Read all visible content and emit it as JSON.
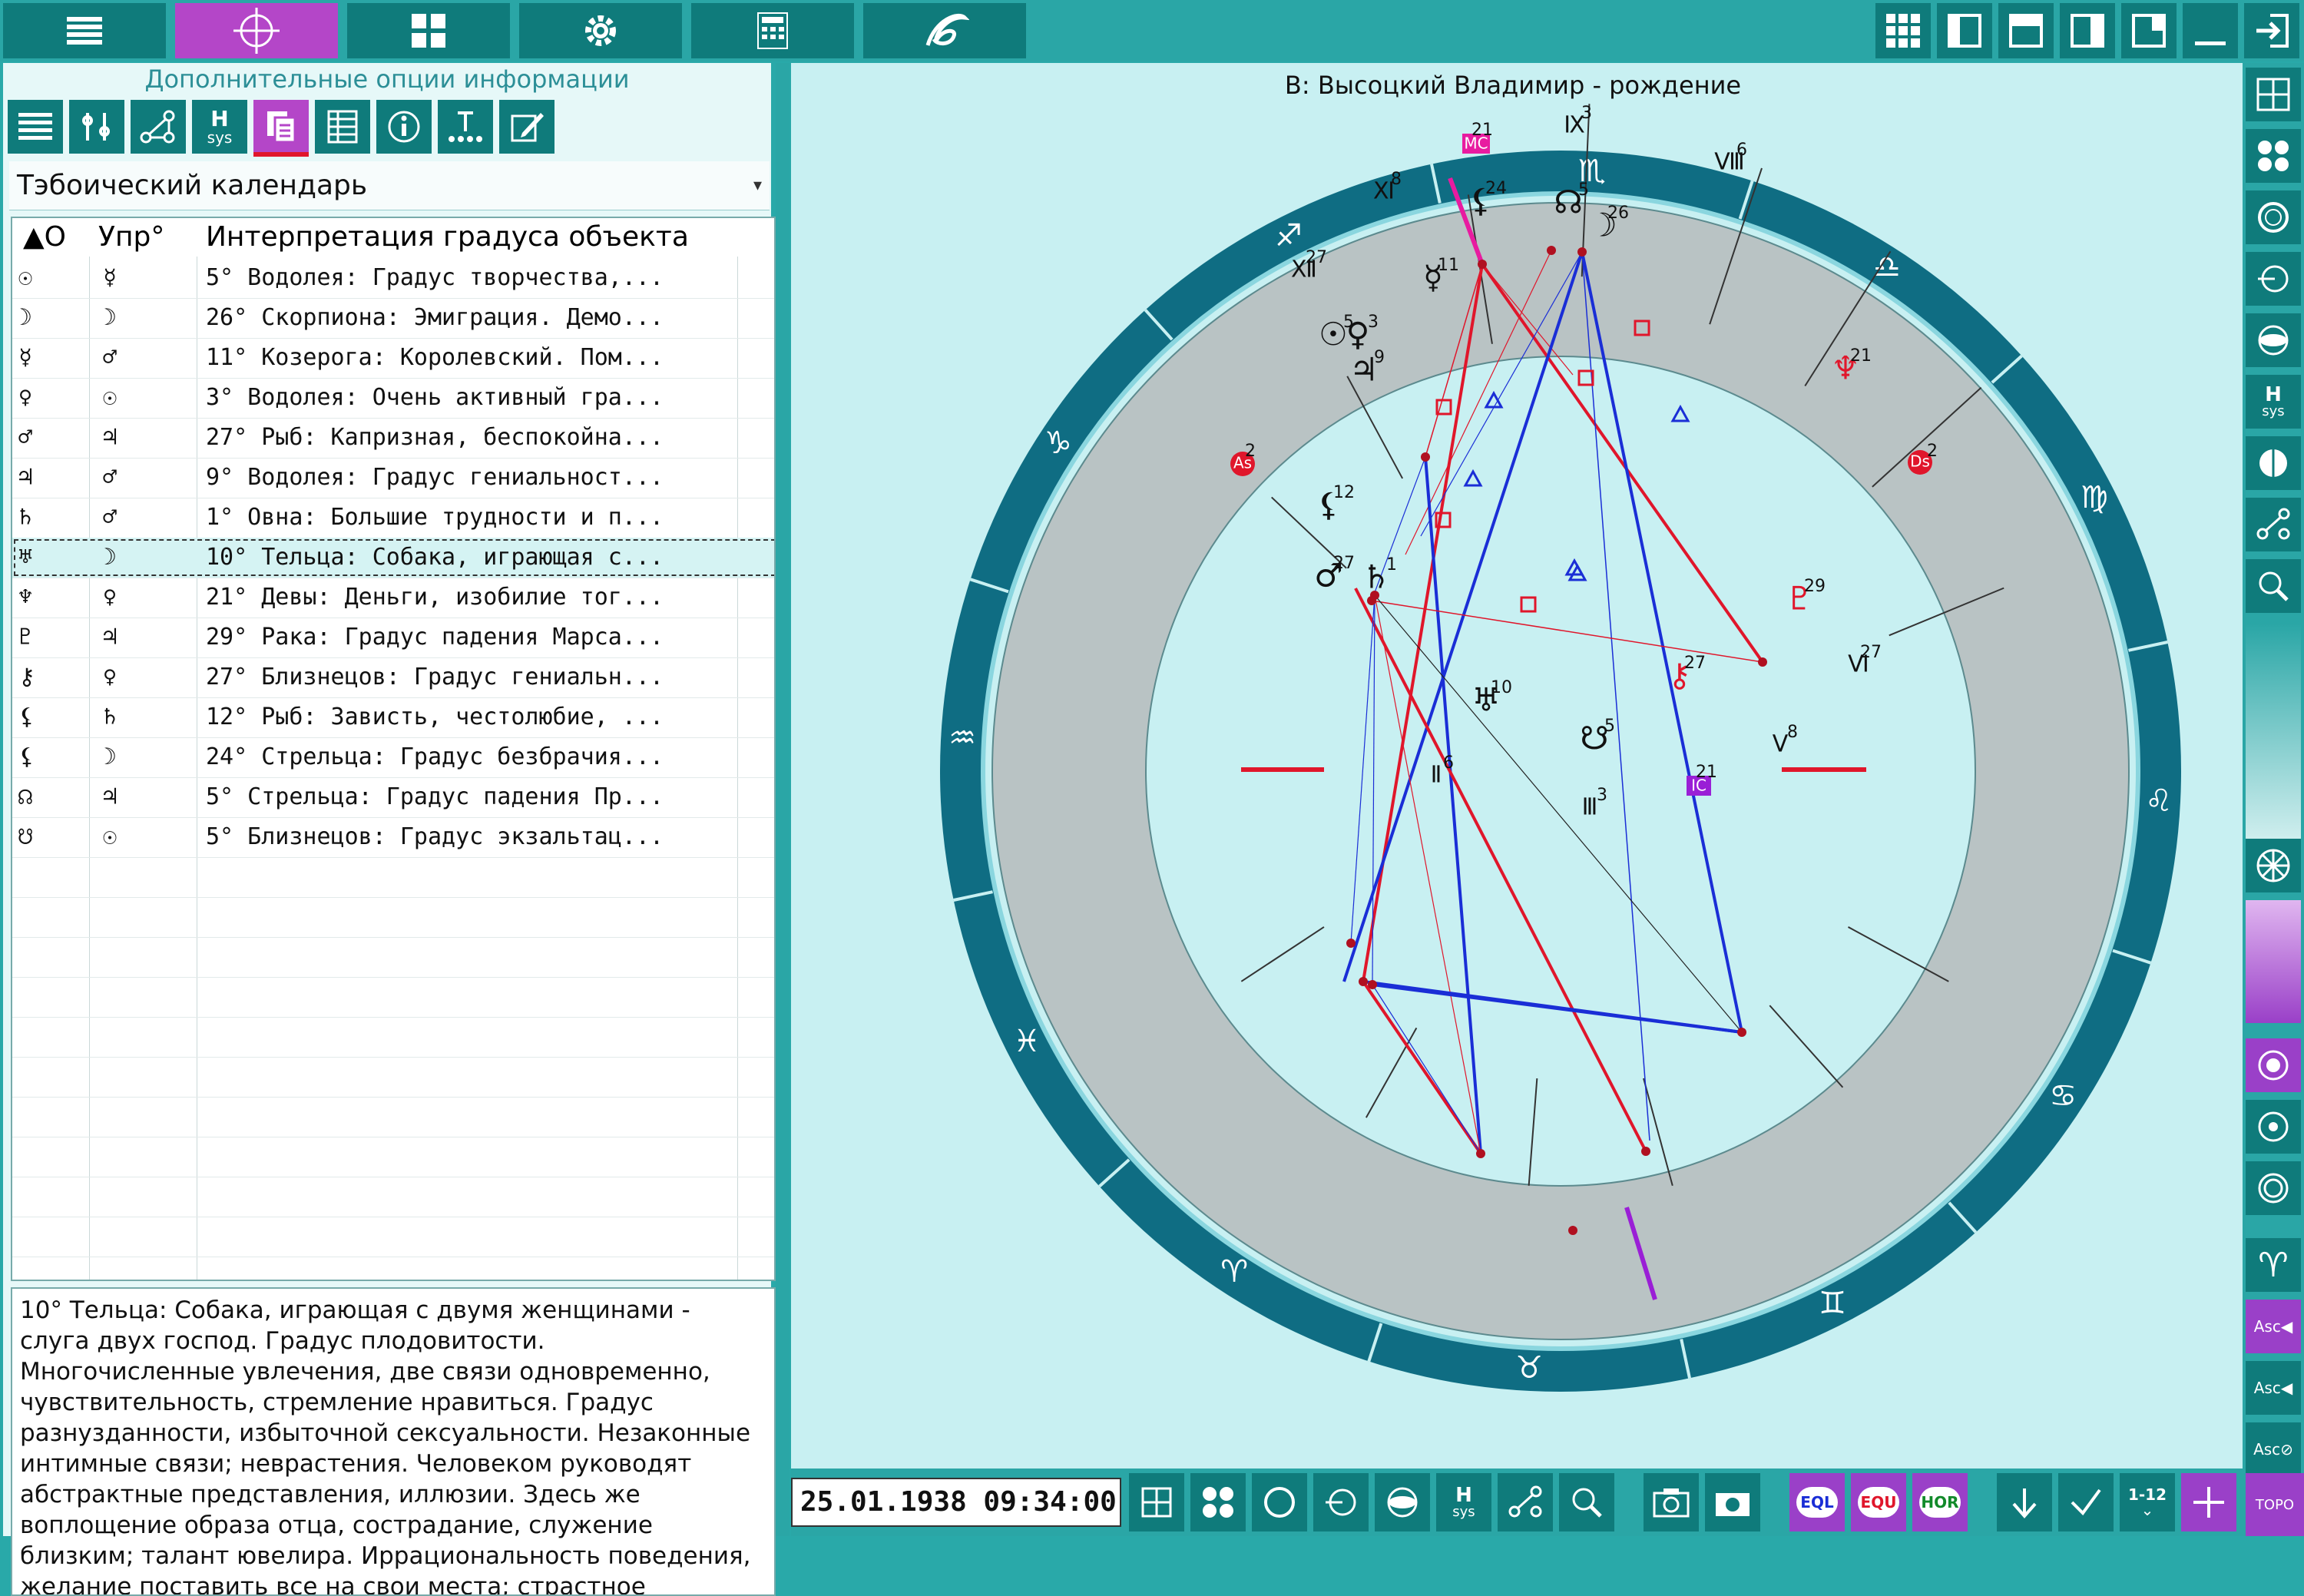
{
  "left_panel": {
    "subtitle": "Дополнительные опции информации",
    "dropdown_value": "Тэбоический календарь",
    "hsys_h": "H",
    "hsys_sys": "sys",
    "columns": [
      "▲O",
      "Упр°",
      "Интерпретация градуса объекта"
    ],
    "rows": [
      {
        "obj": "☉",
        "ruler": "☿",
        "text": "5° Водолея: Градус творчества,..."
      },
      {
        "obj": "☽",
        "ruler": "☽",
        "text": "26° Скорпиона: Эмиграция. Демо..."
      },
      {
        "obj": "☿",
        "ruler": "♂",
        "text": "11° Козерога: Королевский. Пом..."
      },
      {
        "obj": "♀",
        "ruler": "☉",
        "text": "3° Водолея: Очень активный гра..."
      },
      {
        "obj": "♂",
        "ruler": "♃",
        "text": "27° Рыб: Капризная, беспокойна..."
      },
      {
        "obj": "♃",
        "ruler": "♂",
        "text": "9° Водолея: Градус гениальност..."
      },
      {
        "obj": "♄",
        "ruler": "♂",
        "text": "1° Овна: Большие трудности и п..."
      },
      {
        "obj": "♅",
        "ruler": "☽",
        "text": "10° Тельца: Собака, играющая с..."
      },
      {
        "obj": "♆",
        "ruler": "♀",
        "text": "21° Девы: Деньги, изобилие тог..."
      },
      {
        "obj": "♇",
        "ruler": "♃",
        "text": "29° Рака: Градус падения Марса..."
      },
      {
        "obj": "⚷",
        "ruler": "♀",
        "text": "27° Близнецов: Градус гениальн..."
      },
      {
        "obj": "⚸",
        "ruler": "♄",
        "text": "12° Рыб: Зависть, честолюбие, ..."
      },
      {
        "obj": "⚸",
        "ruler": "☽",
        "text": "24° Стрельца: Градус безбрачия..."
      },
      {
        "obj": "☊",
        "ruler": "♃",
        "text": "5° Стрельца: Градус падения Пр..."
      },
      {
        "obj": "☋",
        "ruler": "☉",
        "text": "5° Близнецов: Градус экзальтац..."
      }
    ],
    "selected_row": 7,
    "description": "10° Тельца: Собака, играющая с двумя женщинами - слуга двух господ. Градус плодовитости. Многочисленные увлечения, две связи одновременно, чувствительность, стремление нравиться. Градус разнузданности, избыточной сексуальности. Незаконные интимные связи; неврастения. Человеком руководят абстрактные представления, иллюзии. Здесь же воплощение образа отца, сострадание, служение близким; талант ювелира. Иррациональность поведения, желание поставить все на свои места; страстное отстаивание своих"
  },
  "chart": {
    "title": "В: Высоцкий Владимир - рождение",
    "signs": [
      "♐",
      "♑",
      "♒",
      "♓",
      "♈",
      "♉",
      "♊",
      "♋",
      "♌",
      "♍",
      "♎",
      "♏"
    ],
    "houses": [
      {
        "label": "Ⅸ",
        "deg": "3"
      },
      {
        "label": "Ⅷ",
        "deg": "6"
      },
      {
        "label": "Ⅺ",
        "deg": "8"
      },
      {
        "label": "Ⅻ",
        "deg": "27"
      },
      {
        "label": "Ⅵ",
        "deg": "27"
      },
      {
        "label": "Ⅴ",
        "deg": "8"
      },
      {
        "label": "Ⅱ",
        "deg": "6"
      },
      {
        "label": "Ⅲ",
        "deg": "3"
      }
    ],
    "angles": {
      "mc": "MC",
      "mc_deg": "21",
      "asc": "As",
      "asc_deg": "2",
      "dsc": "Ds",
      "dsc_deg": "2",
      "ic": "IC",
      "ic_deg": "21"
    },
    "planets": [
      {
        "glyph": "☽",
        "deg": "26"
      },
      {
        "glyph": "☊",
        "deg": "5"
      },
      {
        "glyph": "⚸",
        "deg": "24"
      },
      {
        "glyph": "☿",
        "deg": "11"
      },
      {
        "glyph": "☉",
        "deg": "5"
      },
      {
        "glyph": "♀",
        "deg": "3"
      },
      {
        "glyph": "♃",
        "deg": "9"
      },
      {
        "glyph": "♆",
        "deg": "21"
      },
      {
        "glyph": "⚸",
        "deg": "12"
      },
      {
        "glyph": "♂",
        "deg": "27"
      },
      {
        "glyph": "♄",
        "deg": "1"
      },
      {
        "glyph": "♇",
        "deg": "29"
      },
      {
        "glyph": "♅",
        "deg": "10"
      },
      {
        "glyph": "⚷",
        "deg": "27"
      },
      {
        "glyph": "☋",
        "deg": "5"
      }
    ]
  },
  "bottom": {
    "datetime": "25.01.1938 09:34:00",
    "eql": "EQL",
    "equ": "EQU",
    "hor": "HOR",
    "range": "1-12",
    "topo": "ТОРО"
  },
  "right_labels": {
    "asc1": "Asc",
    "asc2": "Asc",
    "asc3": "Asc"
  },
  "colors": {
    "teal": "#0f7b7b",
    "purple": "#b446c8",
    "chart_bg": "#c8f0f2",
    "ring": "#0f6d83",
    "red": "#e0162b",
    "blue": "#1a2ed6"
  }
}
